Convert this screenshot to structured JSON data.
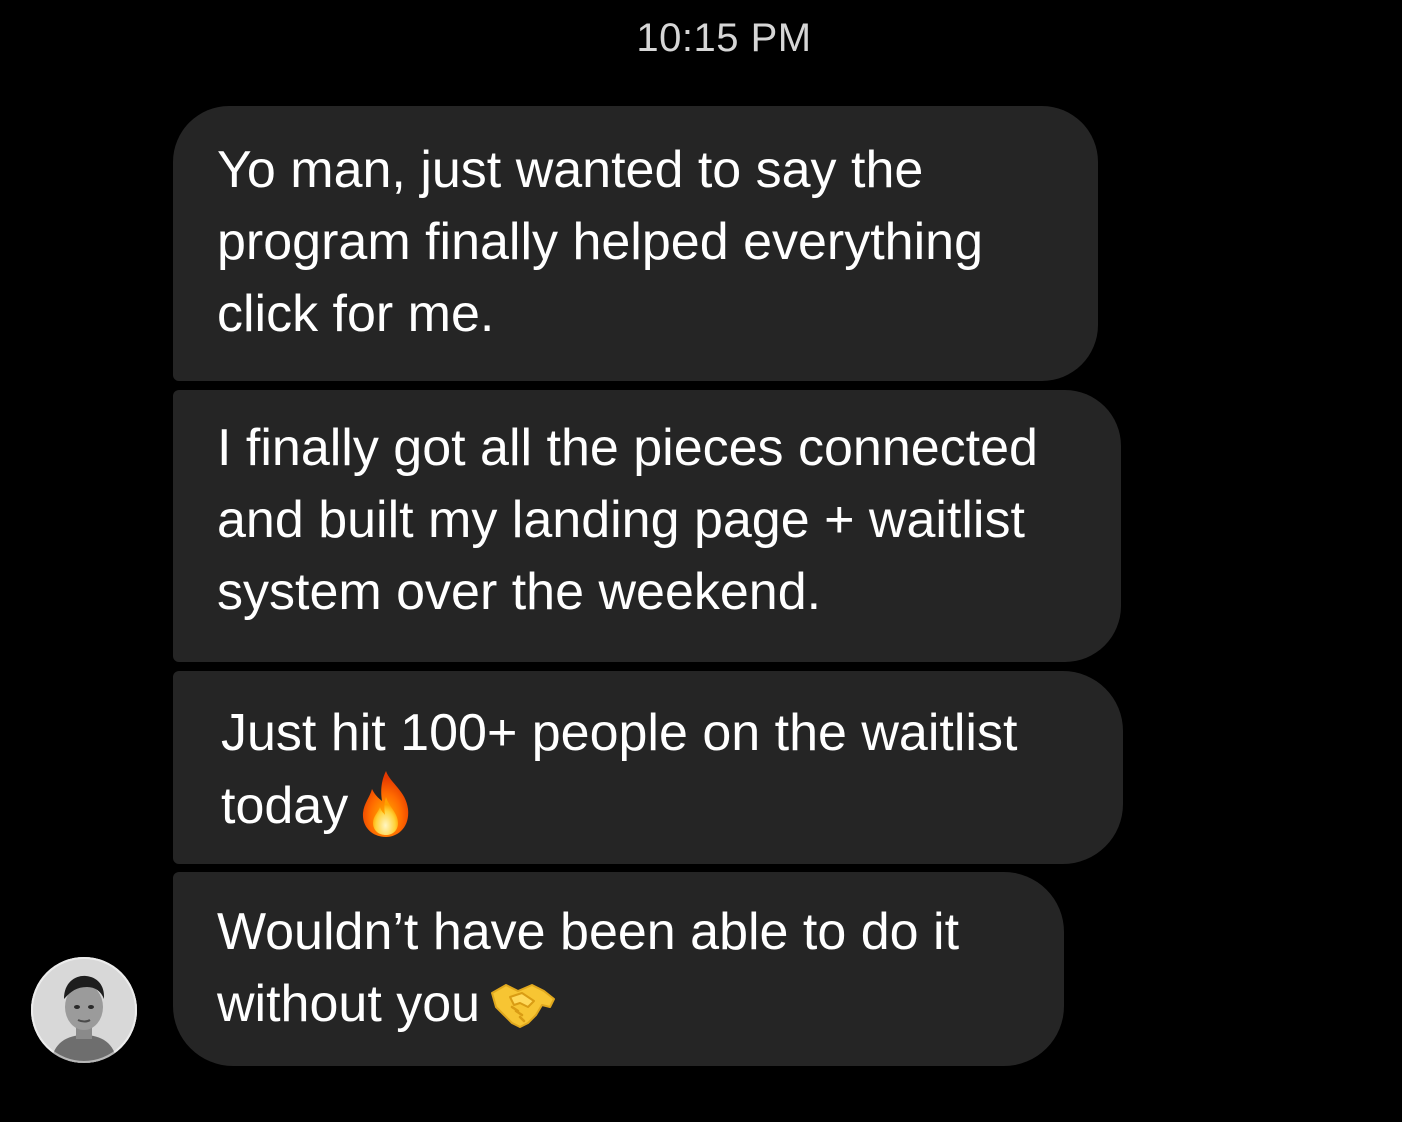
{
  "conversation": {
    "timestamp": "10:15 PM",
    "messages": [
      {
        "lines": [
          "Yo man, just wanted to say the",
          "program finally helped everything",
          "click for me."
        ]
      },
      {
        "lines": [
          "I finally got all the pieces connected",
          "and built my landing page + waitlist",
          "system over the weekend."
        ]
      },
      {
        "lines": [
          "Just hit 100+ people on the waitlist",
          "today"
        ],
        "emoji": "fire-icon"
      },
      {
        "lines": [
          "Wouldn’t have been able to do it",
          "without you"
        ],
        "emoji": "handshake-icon"
      }
    ],
    "sender": {
      "avatar_icon": "avatar-photo"
    }
  },
  "colors": {
    "background": "#000000",
    "bubble": "#252525",
    "text": "#ffffff",
    "timestamp": "#d6d6d6"
  }
}
